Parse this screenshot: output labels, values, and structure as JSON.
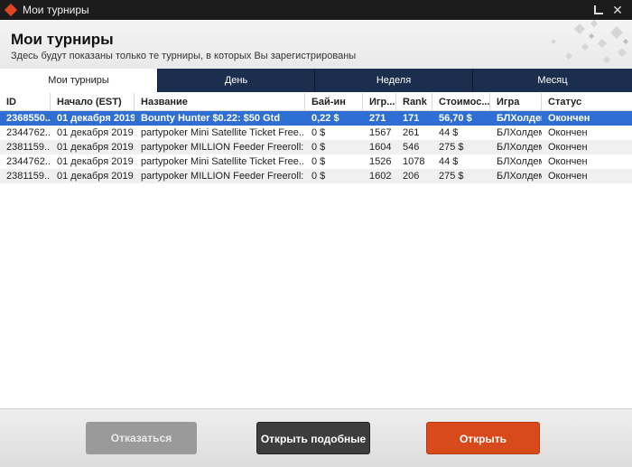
{
  "window": {
    "title": "Мои турниры",
    "close_glyph": "✕",
    "app_icon": "partypoker-diamond-icon"
  },
  "header": {
    "title": "Мои турниры",
    "subtitle": "Здесь будут показаны только те турниры, в которых Вы зарегистрированы"
  },
  "tabs": [
    {
      "label": "Мои турниры",
      "active": true
    },
    {
      "label": "День",
      "active": false
    },
    {
      "label": "Неделя",
      "active": false
    },
    {
      "label": "Месяц",
      "active": false
    }
  ],
  "table": {
    "columns": [
      "ID",
      "Начало (EST)",
      "Название",
      "Бай-ин",
      "Игр...",
      "Rank",
      "Стоимос...",
      "Игра",
      "Статус"
    ],
    "rows": [
      {
        "id": "2368550...",
        "start": "01 декабря 2019...",
        "name": "Bounty Hunter $0.22: $50 Gtd",
        "buyin": "0,22 $",
        "players": "271",
        "rank": "171",
        "cost": "56,70 $",
        "game": "БЛХолдем",
        "status": "Окончен",
        "selected": true
      },
      {
        "id": "2344762...",
        "start": "01 декабря 2019...",
        "name": "partypoker Mini Satellite Ticket Free...",
        "buyin": "0 $",
        "players": "1567",
        "rank": "261",
        "cost": "44 $",
        "game": "БЛХолдем",
        "status": "Окончен",
        "selected": false
      },
      {
        "id": "2381159...",
        "start": "01 декабря 2019...",
        "name": "partypoker MILLION Feeder Freeroll: ...",
        "buyin": "0 $",
        "players": "1604",
        "rank": "546",
        "cost": "275 $",
        "game": "БЛХолдем",
        "status": "Окончен",
        "selected": false
      },
      {
        "id": "2344762...",
        "start": "01 декабря 2019...",
        "name": "partypoker Mini Satellite Ticket Free...",
        "buyin": "0 $",
        "players": "1526",
        "rank": "1078",
        "cost": "44 $",
        "game": "БЛХолдем",
        "status": "Окончен",
        "selected": false
      },
      {
        "id": "2381159...",
        "start": "01 декабря 2019...",
        "name": "partypoker MILLION Feeder Freeroll: ...",
        "buyin": "0 $",
        "players": "1602",
        "rank": "206",
        "cost": "275 $",
        "game": "БЛХолдем",
        "status": "Окончен",
        "selected": false
      }
    ]
  },
  "footer": {
    "cancel_label": "Отказаться",
    "similar_label": "Открыть подобные",
    "open_label": "Открыть"
  },
  "colors": {
    "tab_bar": "#1c2e4e",
    "selected_row": "#2f6fd4",
    "primary_button": "#d8491b"
  }
}
